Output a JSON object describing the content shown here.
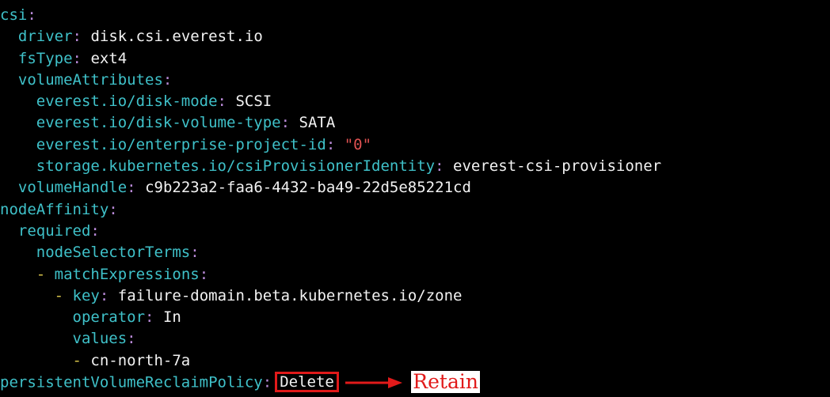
{
  "yaml": {
    "csi_key": "csi",
    "driver_key": "driver",
    "driver_value": "disk.csi.everest.io",
    "fstype_key": "fsType",
    "fstype_value": "ext4",
    "volume_attributes_key": "volumeAttributes",
    "disk_mode_key": "everest.io/disk-mode",
    "disk_mode_value": "SCSI",
    "disk_volume_type_key": "everest.io/disk-volume-type",
    "disk_volume_type_value": "SATA",
    "enterprise_project_key": "everest.io/enterprise-project-id",
    "enterprise_project_value": "\"0\"",
    "provisioner_identity_key": "storage.kubernetes.io/csiProvisionerIdentity",
    "provisioner_identity_value": "everest-csi-provisioner",
    "volume_handle_key": "volumeHandle",
    "volume_handle_value": "c9b223a2-faa6-4432-ba49-22d5e85221cd",
    "node_affinity_key": "nodeAffinity",
    "required_key": "required",
    "node_selector_terms_key": "nodeSelectorTerms",
    "match_expressions_key": "matchExpressions",
    "key_key": "key",
    "key_value": "failure-domain.beta.kubernetes.io/zone",
    "operator_key": "operator",
    "operator_value": "In",
    "values_key": "values",
    "values_item": "cn-north-7a",
    "reclaim_policy_key": "persistentVolumeReclaimPolicy",
    "reclaim_policy_value": "Delete"
  },
  "annotation": {
    "replacement_text": "Retain",
    "accent_color": "#e11a1a"
  },
  "colors": {
    "background": "#000000",
    "key": "#3fc1c9",
    "colon": "#b98ad8",
    "dash": "#d6c24a",
    "value": "#f2f2f2",
    "string": "#e05252"
  }
}
